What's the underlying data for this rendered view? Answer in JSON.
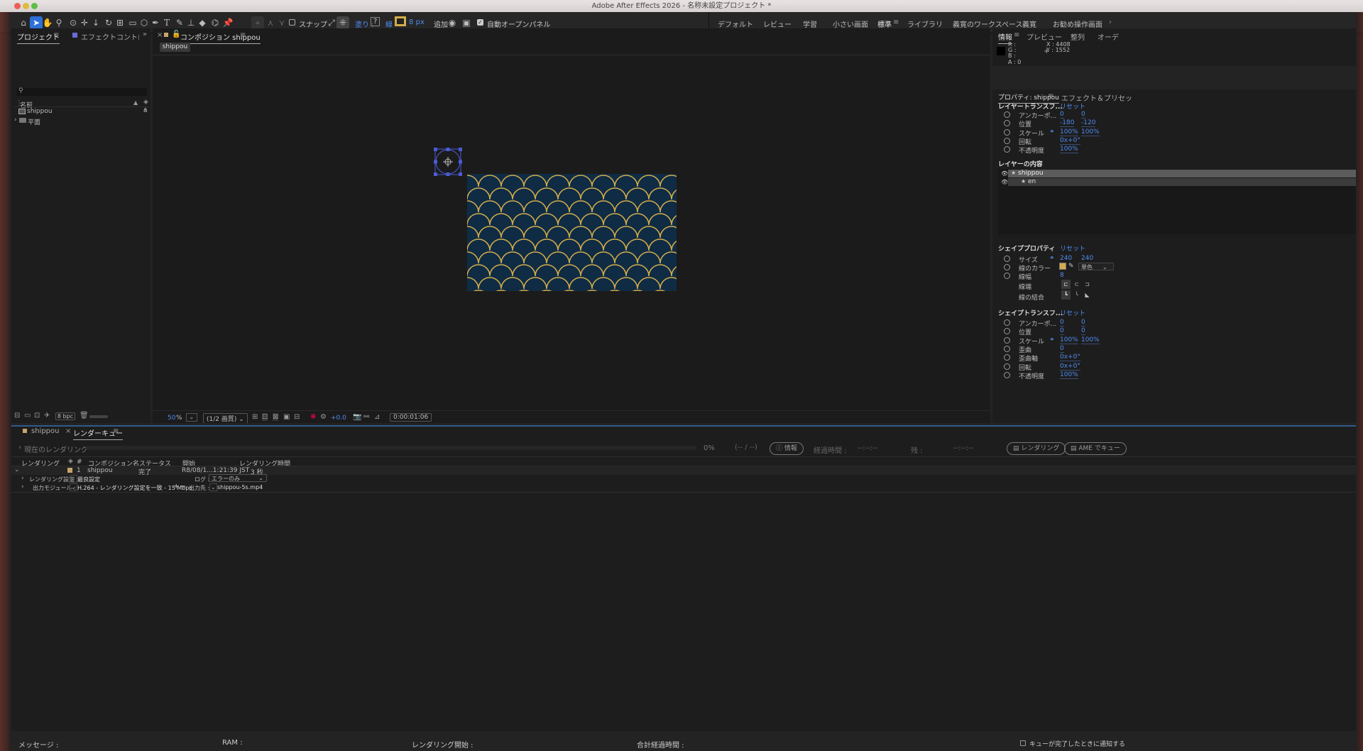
{
  "window": {
    "title": "Adobe After Effects 2026 - 名称未設定プロジェクト *"
  },
  "toolbar": {
    "snap_label": "スナップ",
    "fill_label": "塗り :",
    "fill_value": "?",
    "stroke_label": "線",
    "stroke_width": "8 px",
    "add_label": "追加 :",
    "auto_open_label": "自動オープンパネル"
  },
  "workspaces": [
    "デフォルト",
    "レビュー",
    "学習",
    "小さい画面",
    "標準",
    "ライブラリ",
    "義寛のワークスペース",
    "義寛",
    "お勧め操作画面"
  ],
  "workspace_active": "標準",
  "project_panel": {
    "tab_project": "プロジェクト",
    "tab_effects": "エフェクトコントロール：",
    "col_name": "名前",
    "items": [
      {
        "name": "shippou",
        "type": "composition"
      },
      {
        "name": "平面",
        "type": "folder"
      }
    ],
    "bpc": "8 bpc"
  },
  "comp_panel": {
    "tab": "コンポジション shippou",
    "breadcrumb": "shippou",
    "zoom": "50",
    "zoom_unit": "%",
    "resolution": "(1/2 画質)",
    "exposure": "+0.0",
    "timecode": "0:00:01:06"
  },
  "info_panel": {
    "tabs": [
      "情報",
      "プレビュー",
      "整列",
      "オーデ"
    ],
    "r": "R :",
    "g": "G :",
    "b": "B :",
    "a": "A : 0",
    "x": "X : 4408",
    "y": "Y : 1552"
  },
  "properties": {
    "tabs": [
      "プロパティ: shippou",
      "エフェクト＆プリセッ"
    ],
    "layer_transform": {
      "title": "レイヤートランスフ...",
      "reset": "リセット",
      "rows": [
        {
          "label": "アンカーポ...",
          "v1": "0",
          "v2": "0"
        },
        {
          "label": "位置",
          "v1": "-180",
          "v2": "-120"
        },
        {
          "label": "スケール",
          "v1": "100%",
          "v2": "100%"
        },
        {
          "label": "回転",
          "v1": "0x+0°",
          "v2": ""
        },
        {
          "label": "不透明度",
          "v1": "100%",
          "v2": ""
        }
      ]
    },
    "layer_contents": {
      "title": "レイヤーの内容",
      "items": [
        "shippou",
        "en"
      ]
    },
    "shape_props": {
      "title": "シェイププロパティ",
      "reset": "リセット",
      "size_label": "サイズ",
      "size_w": "240",
      "size_h": "240",
      "stroke_color_label": "線のカラー",
      "stroke_color": "#d4ac4a",
      "stroke_type": "単色",
      "stroke_width_label": "線幅",
      "stroke_width": "8",
      "cap_label": "線端",
      "join_label": "線の結合"
    },
    "shape_transform": {
      "title": "シェイプトランスフ...",
      "reset": "リセット",
      "rows": [
        {
          "label": "アンカーポ...",
          "v1": "0",
          "v2": "0"
        },
        {
          "label": "位置",
          "v1": "0",
          "v2": "0"
        },
        {
          "label": "スケール",
          "v1": "100%",
          "v2": "100%"
        },
        {
          "label": "歪曲",
          "v1": "0",
          "v2": ""
        },
        {
          "label": "歪曲軸",
          "v1": "0x+0°",
          "v2": ""
        },
        {
          "label": "回転",
          "v1": "0x+0°",
          "v2": ""
        },
        {
          "label": "不透明度",
          "v1": "100%",
          "v2": ""
        }
      ]
    }
  },
  "render_queue": {
    "tab_comp": "shippou",
    "tab_rq": "レンダーキュー",
    "current_render": "現在のレンダリング",
    "progress": "0%",
    "frames": "(-- / --)",
    "info_btn": "情報",
    "elapsed_label": "経過時間 :",
    "elapsed": "--:--:--",
    "remaining_label": "残 :",
    "remaining": "--:--:--",
    "render_btn": "レンダリング",
    "ame_btn": "AME でキュー",
    "cols": [
      "レンダリング",
      "#",
      "コンポジション名",
      "ステータス",
      "開始",
      "レンダリング時間"
    ],
    "item": {
      "num": "1",
      "comp": "shippou",
      "status": "完了",
      "start": "R8/08/1...1:21:39 JST",
      "time": "3 秒"
    },
    "settings_label": "レンダリング設定 :",
    "settings_value": "最良設定",
    "log_label": "ログ :",
    "log_value": "エラーのみ",
    "output_module_label": "出力モジュール :",
    "output_module_value": "H.264 - レンダリング設定を一致 - 15 Mbps",
    "output_to_label": "出力先 :",
    "output_to_value": "shippou-5s.mp4"
  },
  "status_bar": {
    "message": "メッセージ :",
    "ram": "RAM :",
    "render_start": "レンダリング開始 :",
    "total_elapsed": "合計経過時間 :",
    "notify": "キューが完了したときに通知する"
  },
  "colors": {
    "accent": "#2e6fd9",
    "canvas_bg": "#0f2c44",
    "pattern_stroke": "#d4ac4a",
    "value_blue": "#4f8cf0"
  }
}
